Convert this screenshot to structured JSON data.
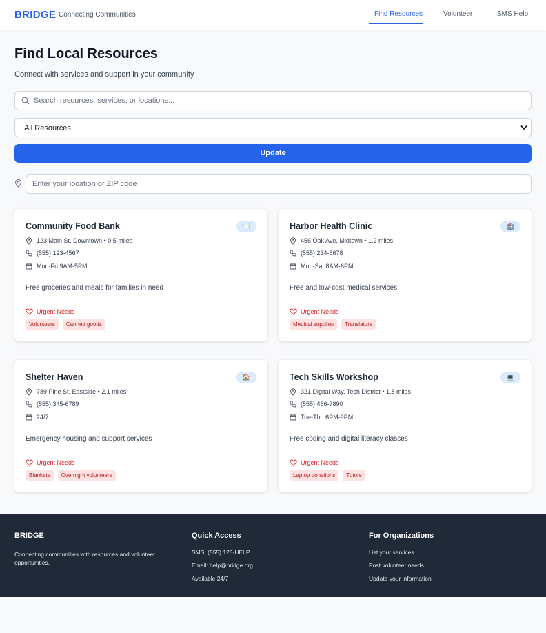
{
  "header": {
    "brand": "BRIDGE",
    "tagline": "Connecting Communities",
    "nav": [
      "Find Resources",
      "Volunteer",
      "SMS Help"
    ]
  },
  "main": {
    "title": "Find Local Resources",
    "subtitle": "Connect with services and support in your community",
    "search_placeholder": "Search resources, services, or locations...",
    "filter_selected": "All Resources",
    "update_label": "Update",
    "location_placeholder": "Enter your location or ZIP code"
  },
  "cards": [
    {
      "name": "Community Food Bank",
      "icon": "🍽️",
      "address": "123 Main St, Downtown • 0.5 miles",
      "phone": "(555) 123-4567",
      "hours": "Mon-Fri 9AM-5PM",
      "description": "Free groceries and meals for families in need",
      "urgent_label": "Urgent Needs",
      "needs": [
        "Volunteers",
        "Canned goods"
      ]
    },
    {
      "name": "Harbor Health Clinic",
      "icon": "🏥",
      "address": "456 Oak Ave, Midtown • 1.2 miles",
      "phone": "(555) 234-5678",
      "hours": "Mon-Sat 8AM-6PM",
      "description": "Free and low-cost medical services",
      "urgent_label": "Urgent Needs",
      "needs": [
        "Medical supplies",
        "Translators"
      ]
    },
    {
      "name": "Shelter Haven",
      "icon": "🏠",
      "address": "789 Pine St, Eastside • 2.1 miles",
      "phone": "(555) 345-6789",
      "hours": "24/7",
      "description": "Emergency housing and support services",
      "urgent_label": "Urgent Needs",
      "needs": [
        "Blankets",
        "Overnight volunteers"
      ]
    },
    {
      "name": "Tech Skills Workshop",
      "icon": "💻",
      "address": "321 Digital Way, Tech District • 1.8 miles",
      "phone": "(555) 456-7890",
      "hours": "Tue-Thu 6PM-9PM",
      "description": "Free coding and digital literacy classes",
      "urgent_label": "Urgent Needs",
      "needs": [
        "Laptop donations",
        "Tutors"
      ]
    }
  ],
  "footer": {
    "brand": "BRIDGE",
    "description": "Connecting communities with resources and volunteer opportunities.",
    "quick_access": {
      "heading": "Quick Access",
      "items": [
        "SMS: (555) 123-HELP",
        "Email: help@bridge.org",
        "Available 24/7"
      ]
    },
    "organizations": {
      "heading": "For Organizations",
      "items": [
        "List your services",
        "Post volunteer needs",
        "Update your information"
      ]
    }
  },
  "colors": {
    "accent": "#2563eb",
    "urgent": "#dc2626",
    "tag_bg": "#fee2e2",
    "footer_bg": "#1f2937"
  }
}
